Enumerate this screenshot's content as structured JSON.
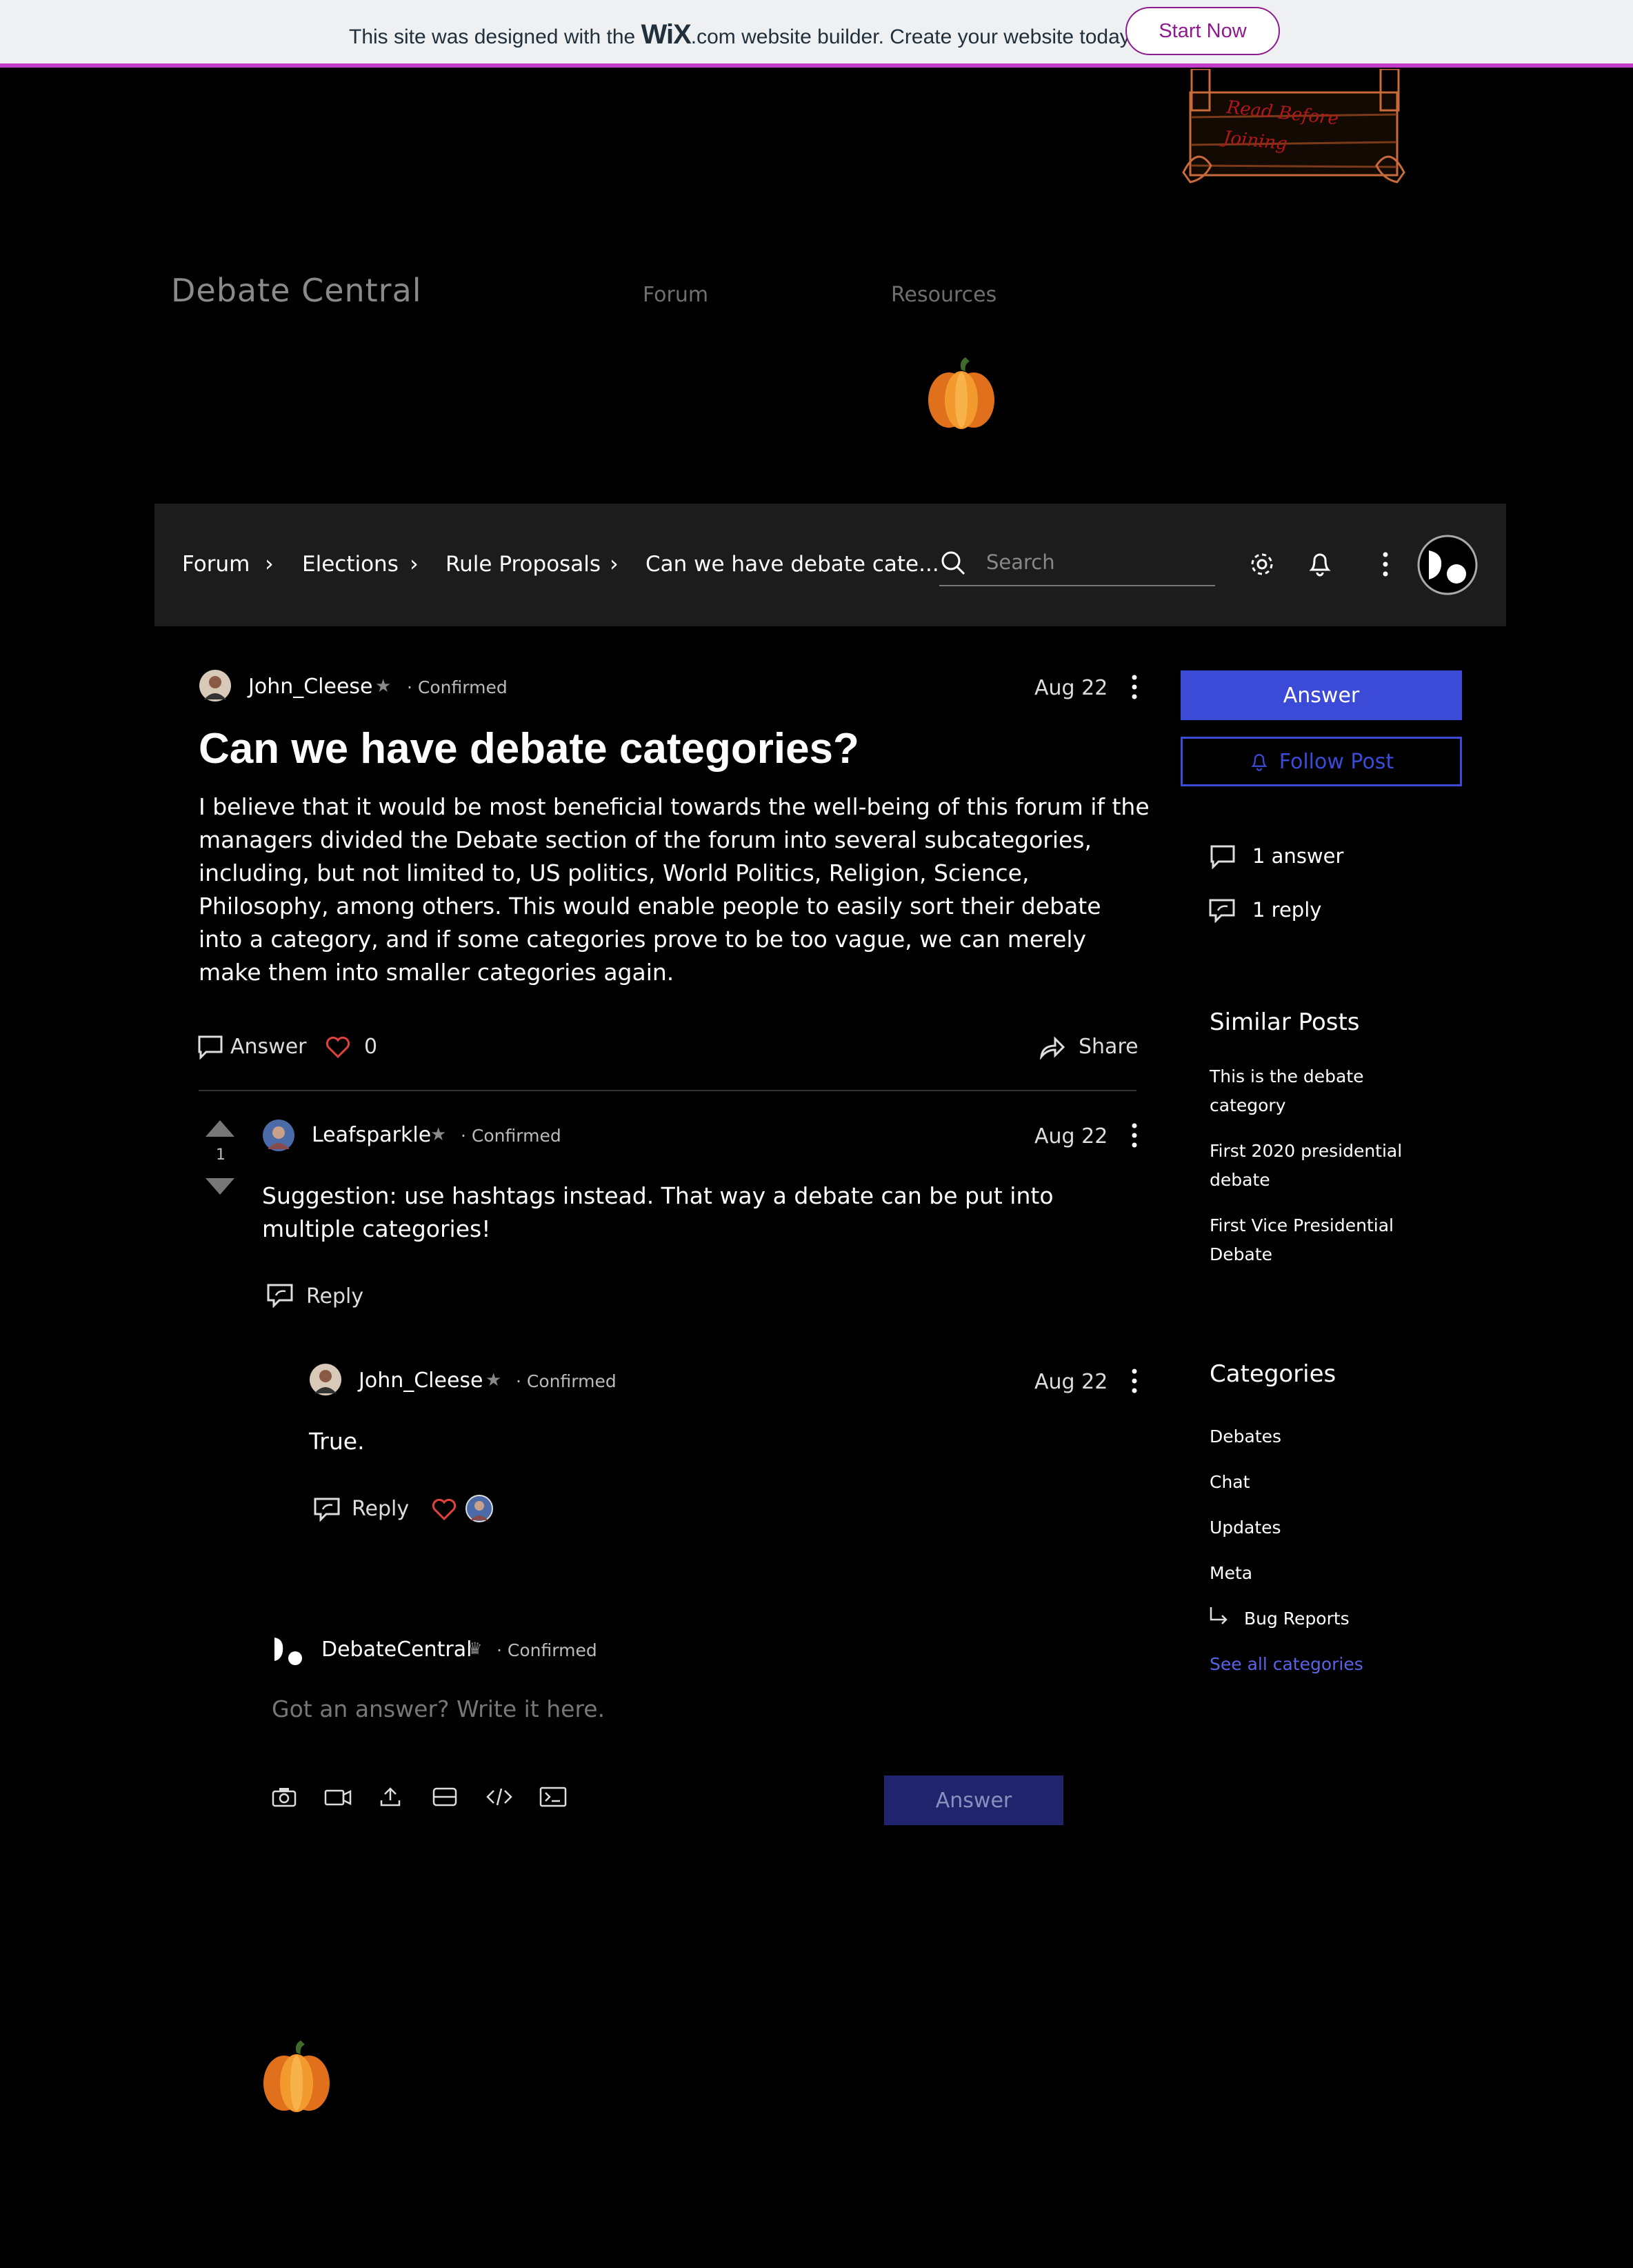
{
  "banner": {
    "text_before": "This site was designed with the",
    "brand": "WiX",
    "text_after": ".com website builder. Create your website today.",
    "cta": "Start Now"
  },
  "header": {
    "site_title": "Debate Central",
    "logo_text": "Read Before Joining",
    "nav": [
      "Forum",
      "Resources"
    ]
  },
  "forum_bar": {
    "breadcrumbs": [
      "Forum",
      "Elections",
      "Rule Proposals",
      "Can we have debate cate..."
    ],
    "search_placeholder": "Search"
  },
  "post": {
    "author": "John_Cleese",
    "status": "Confirmed",
    "date": "Aug 22",
    "title": "Can we have debate categories?",
    "body": "I believe that it would be most beneficial towards the well-being of this forum if the managers divided the Debate section of the forum into several subcategories, including, but not limited to, US politics, World Politics, Religion, Science, Philosophy, among others. This would enable people to easily sort their debate into a category, and if some categories prove to be too vague, we can merely make them into smaller categories again.",
    "answer_label": "Answer",
    "likes": "0",
    "share_label": "Share"
  },
  "answer": {
    "votes": "1",
    "author": "Leafsparkle",
    "status": "Confirmed",
    "date": "Aug 22",
    "body": "Suggestion: use hashtags instead. That way a debate can be put into multiple categories!",
    "reply_label": "Reply"
  },
  "reply": {
    "author": "John_Cleese",
    "status": "Confirmed",
    "date": "Aug 22",
    "body": "True.",
    "reply_label": "Reply"
  },
  "composer": {
    "author": "DebateCentral",
    "status": "Confirmed",
    "placeholder": "Got an answer? Write it here.",
    "submit": "Answer"
  },
  "sidebar": {
    "answer_button": "Answer",
    "follow_button": "Follow Post",
    "answers_count": "1 answer",
    "replies_count": "1 reply",
    "similar_heading": "Similar Posts",
    "similar_posts": [
      "This is the debate category",
      "First 2020 presidential debate",
      "First Vice Presidential Debate"
    ],
    "categories_heading": "Categories",
    "categories": [
      "Debates",
      "Chat",
      "Updates",
      "Meta",
      "Bug Reports"
    ],
    "see_all": "See all categories"
  },
  "colors": {
    "accent": "#3b4bd8",
    "banner_border": "#c13cc7",
    "like_heart": "#e0413c",
    "link": "#5a63e6"
  }
}
